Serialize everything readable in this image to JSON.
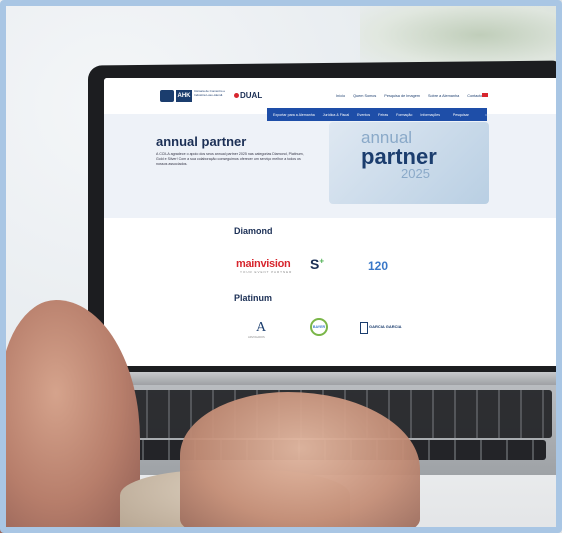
{
  "header": {
    "ahk_logo": "AHK",
    "ahk_org_text": "Câmara de Comércio e Indústria Luso-Alemã",
    "dual_logo": "DUAL",
    "top_nav": [
      "Início",
      "Quem Somos",
      "Pesquisa de Imagem",
      "Sobre a Alemanha",
      "Contactos"
    ],
    "blue_nav": [
      "Exportar para a Alemanha",
      "Jurídica & Fiscal",
      "Eventos",
      "Feiras",
      "Formação",
      "Informações",
      "Pesquisar"
    ]
  },
  "hero": {
    "title": "annual partner",
    "text": "A CCILA agradece o apoio dos seus annual partner 2025 nas categorias Diamond, Platinum, Gold e Silver! Com a sua colaboração conseguimos oferecer um serviço melhor a todos os nossos associados.",
    "card_line1": "annual",
    "card_line2": "partner",
    "card_line3": "2025"
  },
  "sections": {
    "diamond": "Diamond",
    "platinum": "Platinum"
  },
  "logos": {
    "mainvision": "mainvision",
    "mainvision_tagline": "YOUR EVENT PARTNER",
    "splus": "S",
    "splus_mark": "+",
    "n120": "120",
    "logo_a": "A",
    "logo_a_sub": "ADVOGADOS",
    "bayer": "BAYER",
    "garcia": "GARCIA GARCIA"
  }
}
